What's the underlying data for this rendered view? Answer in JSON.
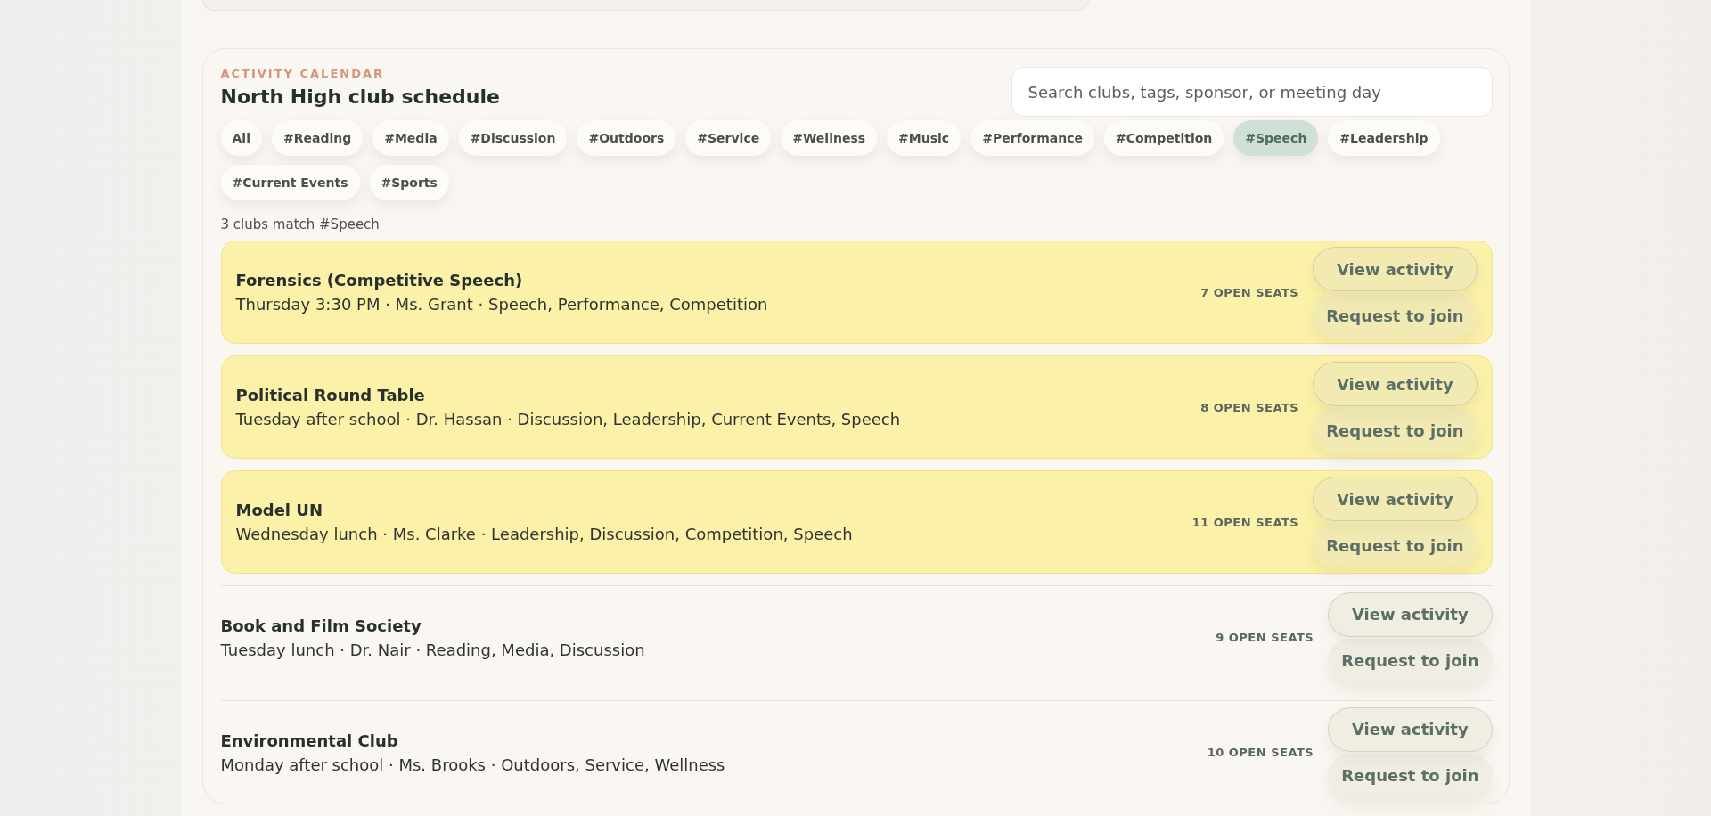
{
  "calendar": {
    "eyebrow": "ACTIVITY CALENDAR",
    "title": "North High club schedule",
    "search": {
      "placeholder": "Search clubs, tags, sponsor, or meeting day"
    },
    "tags": [
      {
        "label": "All",
        "selected": false
      },
      {
        "label": "#Reading",
        "selected": false
      },
      {
        "label": "#Media",
        "selected": false
      },
      {
        "label": "#Discussion",
        "selected": false
      },
      {
        "label": "#Outdoors",
        "selected": false
      },
      {
        "label": "#Service",
        "selected": false
      },
      {
        "label": "#Wellness",
        "selected": false
      },
      {
        "label": "#Music",
        "selected": false
      },
      {
        "label": "#Performance",
        "selected": false
      },
      {
        "label": "#Competition",
        "selected": false
      },
      {
        "label": "#Speech",
        "selected": true
      },
      {
        "label": "#Leadership",
        "selected": false
      },
      {
        "label": "#Current Events",
        "selected": false
      },
      {
        "label": "#Sports",
        "selected": false
      }
    ],
    "match_count": "3 clubs match #Speech",
    "clubs": [
      {
        "name": "Forensics (Competitive Speech)",
        "details": "Thursday 3:30 PM · Ms. Grant · Speech, Performance, Competition",
        "seats": "7 OPEN SEATS",
        "highlighted": true,
        "buttons": [
          "View activity",
          "Request to join"
        ]
      },
      {
        "name": "Political Round Table",
        "details": "Tuesday after school · Dr. Hassan · Discussion, Leadership, Current Events, Speech",
        "seats": "8 OPEN SEATS",
        "highlighted": true,
        "buttons": [
          "View activity",
          "Request to join"
        ]
      },
      {
        "name": "Model UN",
        "details": "Wednesday lunch · Ms. Clarke · Leadership, Discussion, Competition, Speech",
        "seats": "11 OPEN SEATS",
        "highlighted": true,
        "buttons": [
          "View activity",
          "Request to join"
        ]
      },
      {
        "name": "Book and Film Society",
        "details": "Tuesday lunch · Dr. Nair · Reading, Media, Discussion",
        "seats": "9 OPEN SEATS",
        "highlighted": false,
        "buttons": [
          "View activity",
          "Request to join"
        ]
      },
      {
        "name": "Environmental Club",
        "details": "Monday after school · Ms. Brooks · Outdoors, Service, Wellness",
        "seats": "10 OPEN SEATS",
        "highlighted": false,
        "buttons": [
          "View activity",
          "Request to join"
        ]
      }
    ]
  }
}
